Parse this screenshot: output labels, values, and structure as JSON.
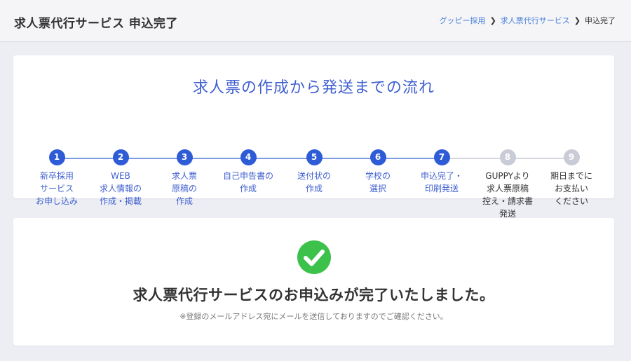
{
  "header": {
    "title": "求人票代行サービス 申込完了",
    "breadcrumb": [
      {
        "label": "グッピー採用"
      },
      {
        "label": "求人票代行サービス"
      },
      {
        "label": "申込完了"
      }
    ]
  },
  "flow": {
    "title": "求人票の作成から発送までの流れ",
    "steps": [
      {
        "number": "1",
        "label": "新卒採用\nサービス\nお申し込み",
        "state": "done"
      },
      {
        "number": "2",
        "label": "WEB\n求人情報の\n作成・掲載",
        "state": "done"
      },
      {
        "number": "3",
        "label": "求人票\n原稿の\n作成",
        "state": "done"
      },
      {
        "number": "4",
        "label": "自己申告書の\n作成",
        "state": "done"
      },
      {
        "number": "5",
        "label": "送付状の\n作成",
        "state": "done"
      },
      {
        "number": "6",
        "label": "学校の\n選択",
        "state": "done"
      },
      {
        "number": "7",
        "label": "申込完了・\n印刷発送",
        "state": "done"
      },
      {
        "number": "8",
        "label": "GUPPYより\n求人票原稿\n控え・請求書\n発送",
        "state": "future"
      },
      {
        "number": "9",
        "label": "期日までに\nお支払い\nください",
        "state": "future"
      }
    ]
  },
  "completion": {
    "icon": "check-circle-icon",
    "message": "求人票代行サービスのお申込みが完了いたしました。",
    "note": "※登録のメールアドレス宛にメールを送信しておりますのでご確認ください。"
  },
  "colors": {
    "accent": "#2e5bd6",
    "inactive": "#c9cbd6",
    "success": "#3cc14b"
  }
}
